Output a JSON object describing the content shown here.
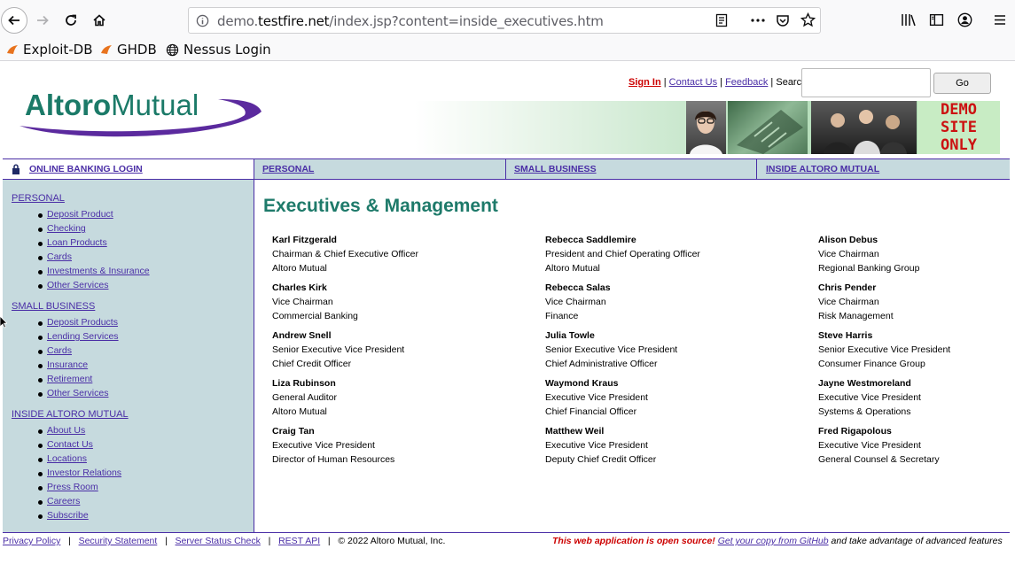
{
  "browser": {
    "url_prefix": "demo.",
    "url_domain": "testfire.net",
    "url_path": "/index.jsp?content=inside_executives.htm",
    "bookmarks": [
      "Exploit-DB",
      "GHDB",
      "Nessus Login"
    ]
  },
  "header": {
    "logo_alt": "Altoro",
    "logo_text": "Mutual",
    "sign_in": "Sign In",
    "contact_us": "Contact Us",
    "feedback": "Feedback",
    "search_label": "Search",
    "go_label": "Go",
    "demo_line1": "DEMO",
    "demo_line2": "SITE",
    "demo_line3": "ONLY"
  },
  "nav": {
    "login": "ONLINE BANKING LOGIN",
    "personal": "PERSONAL",
    "small_business": "SMALL BUSINESS",
    "inside": "INSIDE ALTORO MUTUAL"
  },
  "sidebar": {
    "personal_head": "PERSONAL",
    "personal_items": [
      "Deposit Product",
      "Checking",
      "Loan Products",
      "Cards",
      "Investments & Insurance",
      "Other Services"
    ],
    "business_head": "SMALL BUSINESS",
    "business_items": [
      "Deposit Products",
      "Lending Services",
      "Cards",
      "Insurance",
      "Retirement",
      "Other Services"
    ],
    "inside_head": "INSIDE ALTORO MUTUAL",
    "inside_items": [
      "About Us",
      "Contact Us",
      "Locations",
      "Investor Relations",
      "Press Room",
      "Careers",
      "Subscribe"
    ]
  },
  "main": {
    "title": "Executives & Management",
    "columns": [
      [
        {
          "name": "Karl Fitzgerald",
          "title": "Chairman & Chief Executive Officer",
          "dept": "Altoro Mutual"
        },
        {
          "name": "Charles Kirk",
          "title": "Vice Chairman",
          "dept": "Commercial Banking"
        },
        {
          "name": "Andrew Snell",
          "title": "Senior Executive Vice President",
          "dept": "Chief Credit Officer"
        },
        {
          "name": "Liza Rubinson",
          "title": "General Auditor",
          "dept": "Altoro Mutual"
        },
        {
          "name": "Craig Tan",
          "title": "Executive Vice President",
          "dept": "Director of Human Resources"
        }
      ],
      [
        {
          "name": "Rebecca Saddlemire",
          "title": "President and Chief Operating Officer",
          "dept": "Altoro Mutual"
        },
        {
          "name": "Rebecca Salas",
          "title": "Vice Chairman",
          "dept": "Finance"
        },
        {
          "name": "Julia Towle",
          "title": "Senior Executive Vice President",
          "dept": "Chief Administrative Officer"
        },
        {
          "name": "Waymond Kraus",
          "title": "Executive Vice President",
          "dept": "Chief Financial Officer"
        },
        {
          "name": "Matthew Weil",
          "title": "Executive Vice President",
          "dept": "Deputy Chief Credit Officer"
        }
      ],
      [
        {
          "name": "Alison Debus",
          "title": "Vice Chairman",
          "dept": "Regional Banking Group"
        },
        {
          "name": "Chris Pender",
          "title": "Vice Chairman",
          "dept": "Risk Management"
        },
        {
          "name": "Steve Harris",
          "title": "Senior Executive Vice President",
          "dept": "Consumer Finance Group"
        },
        {
          "name": "Jayne Westmoreland",
          "title": "Executive Vice President",
          "dept": "Systems & Operations"
        },
        {
          "name": "Fred Rigapolous",
          "title": "Executive Vice President",
          "dept": "General Counsel & Secretary"
        }
      ]
    ]
  },
  "footer": {
    "privacy": "Privacy Policy",
    "security": "Security Statement",
    "status": "Server Status Check",
    "rest": "REST API",
    "copyright": "© 2022 Altoro Mutual, Inc.",
    "open_source": "This web application is open source!",
    "github": "Get your copy from GitHub",
    "advantage": "and take advantage of advanced features"
  },
  "colors": {
    "link": "#4a2ea6",
    "heading": "#1e7a6a",
    "sidebar_bg": "#c6dade",
    "alert_red": "#cc1111"
  }
}
